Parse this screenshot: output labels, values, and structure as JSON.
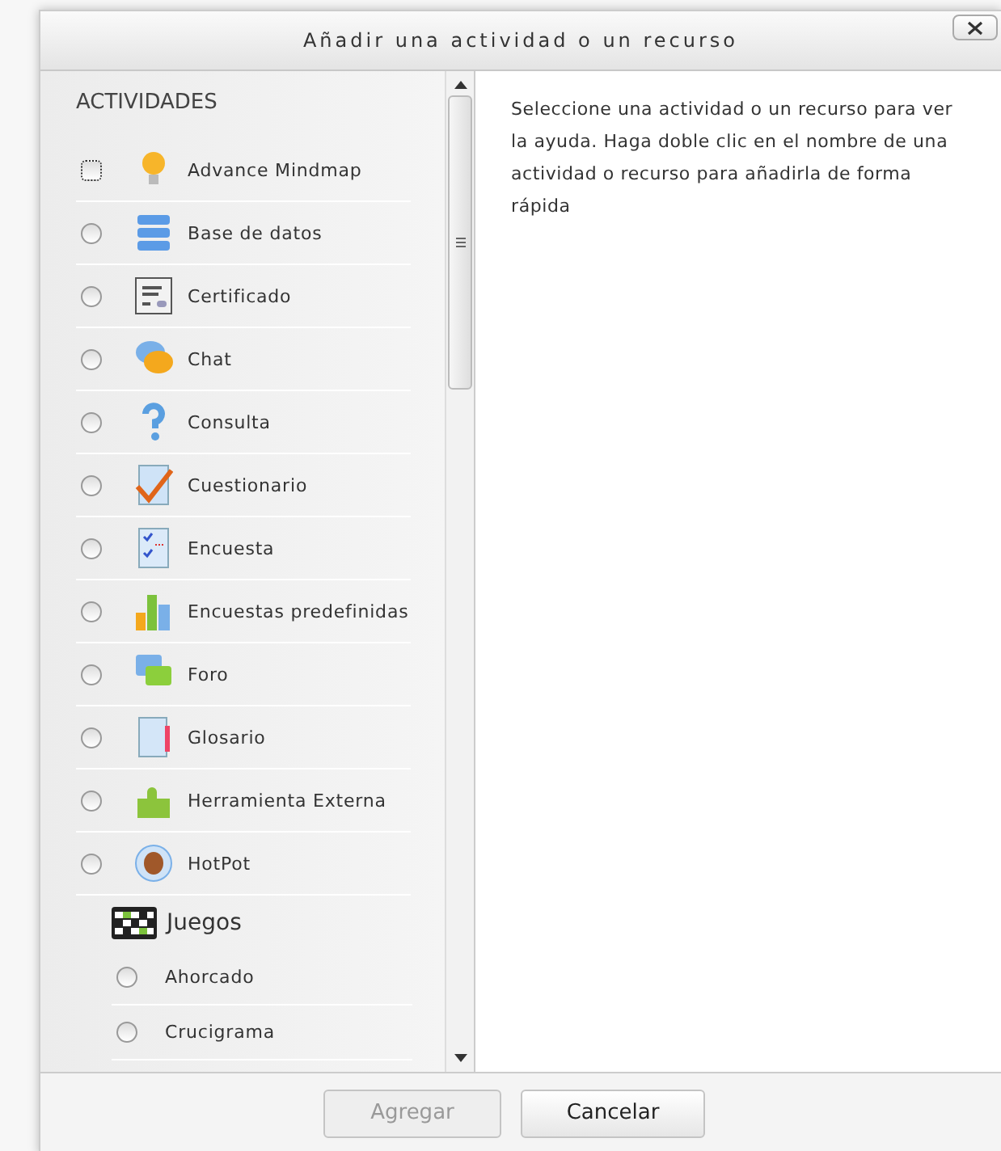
{
  "dialog": {
    "title": "Añadir una actividad o un recurso"
  },
  "activities": {
    "heading": "ACTIVIDADES",
    "items": [
      {
        "label": "Advance Mindmap",
        "selected": false,
        "focused": true
      },
      {
        "label": "Base de datos",
        "selected": false,
        "focused": false
      },
      {
        "label": "Certificado",
        "selected": false,
        "focused": false
      },
      {
        "label": "Chat",
        "selected": false,
        "focused": false
      },
      {
        "label": "Consulta",
        "selected": false,
        "focused": false
      },
      {
        "label": "Cuestionario",
        "selected": false,
        "focused": false
      },
      {
        "label": "Encuesta",
        "selected": false,
        "focused": false
      },
      {
        "label": "Encuestas predefinidas",
        "selected": false,
        "focused": false
      },
      {
        "label": "Foro",
        "selected": false,
        "focused": false
      },
      {
        "label": "Glosario",
        "selected": false,
        "focused": false
      },
      {
        "label": "Herramienta Externa",
        "selected": false,
        "focused": false
      },
      {
        "label": "HotPot",
        "selected": false,
        "focused": false
      }
    ],
    "groups": [
      {
        "label": "Juegos",
        "items": [
          {
            "label": "Ahorcado",
            "selected": false,
            "focused": false
          },
          {
            "label": "Crucigrama",
            "selected": false,
            "focused": false
          }
        ]
      }
    ]
  },
  "help_text": "Seleccione una actividad o un recurso para ver la ayuda. Haga doble clic en el nombre de una actividad o recurso para añadirla de forma rápida",
  "buttons": [
    {
      "label": "Agregar",
      "disabled": true
    },
    {
      "label": "Cancelar",
      "disabled": false
    }
  ]
}
